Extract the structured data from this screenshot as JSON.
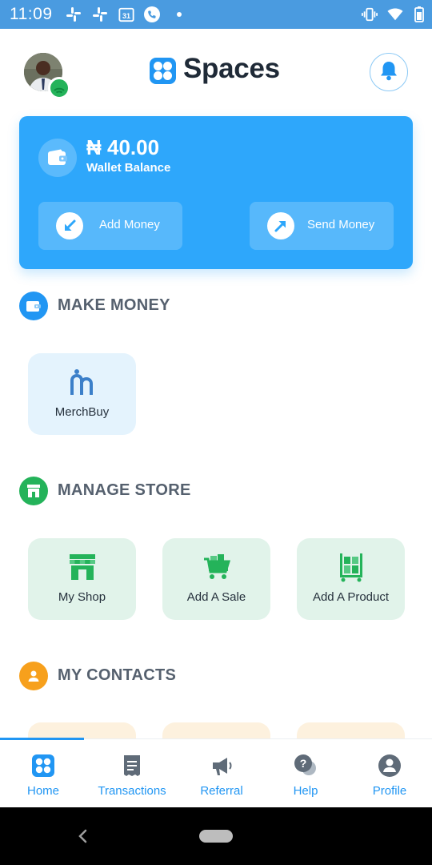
{
  "status_bar": {
    "time": "11:09",
    "calendar_day": "31",
    "icons": [
      "slack-icon",
      "slack-icon",
      "calendar-icon",
      "phone-icon",
      "dot-icon",
      "vibrate-icon",
      "wifi-icon",
      "battery-icon"
    ]
  },
  "header": {
    "app_name": "Spaces",
    "avatar": "user-avatar",
    "notification_icon": "bell-icon"
  },
  "wallet": {
    "amount": "₦ 40.00",
    "label": "Wallet Balance",
    "add_money_label": "Add Money",
    "send_money_label": "Send Money"
  },
  "make_money": {
    "title": "MAKE MONEY",
    "items": [
      {
        "label": "MerchBuy",
        "icon": "merchbuy-icon"
      }
    ]
  },
  "manage_store": {
    "title": "MANAGE STORE",
    "items": [
      {
        "label": "My Shop",
        "icon": "shop-icon"
      },
      {
        "label": "Add A Sale",
        "icon": "cart-icon"
      },
      {
        "label": "Add A Product",
        "icon": "product-trolley-icon"
      }
    ]
  },
  "my_contacts": {
    "title": "MY CONTACTS"
  },
  "tabs": [
    {
      "label": "Home",
      "icon": "home-icon",
      "active": true
    },
    {
      "label": "Transactions",
      "icon": "receipt-icon",
      "active": false
    },
    {
      "label": "Referral",
      "icon": "megaphone-icon",
      "active": false
    },
    {
      "label": "Help",
      "icon": "help-chat-icon",
      "active": false
    },
    {
      "label": "Profile",
      "icon": "profile-icon",
      "active": false
    }
  ],
  "colors": {
    "primary": "#2196f3",
    "wallet_card": "#2ea7fb",
    "green": "#24b35a",
    "orange": "#f7a01c",
    "status_bar": "#4a9be0"
  }
}
